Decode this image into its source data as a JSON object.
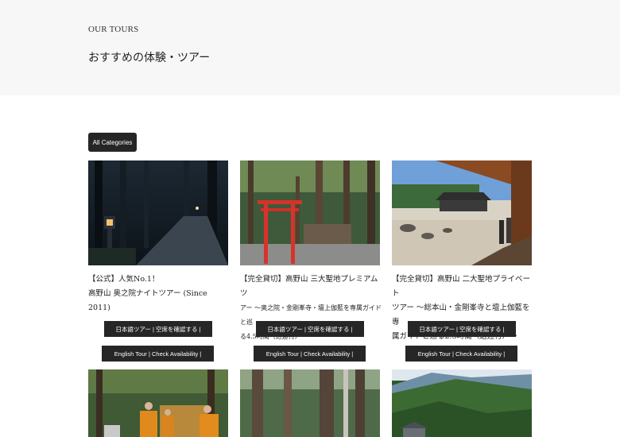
{
  "header": {
    "eyebrow": "OUR TOURS",
    "title": "おすすめの体験・ツアー"
  },
  "filter": {
    "all_categories": "All Categories"
  },
  "cards": [
    {
      "title_line1": "【公式】人気No.1！",
      "title_line2": "高野山 奥之院ナイトツアー (Since 2011)",
      "jp_button": "日本語ツアー | 空席を確認する |",
      "en_button": "English Tour | Check Availability |"
    },
    {
      "title_line1": "【完全貸切】高野山 三大聖地プレミアムツ",
      "title_line2": "アー ～奥之院・金剛峯寺・壇上伽藍を専属ガイドと巡",
      "title_line3": "る4.5時間（送迎付）～",
      "jp_button": "日本語ツアー | 空席を確認する |",
      "en_button": "English Tour | Check Availability |"
    },
    {
      "title_line1": "【完全貸切】高野山 二大聖地プライベート",
      "title_line2": "ツアー ～総本山・金剛峯寺と壇上伽藍を専",
      "title_line3": "属ガイドと巡る2.5時間（送迎付）～",
      "jp_button": "日本語ツアー | 空席を確認する |",
      "en_button": "English Tour | Check Availability |"
    }
  ],
  "colors": {
    "hero_bg": "#f7f7f7",
    "button_bg": "#262626",
    "button_text": "#ffffff"
  }
}
